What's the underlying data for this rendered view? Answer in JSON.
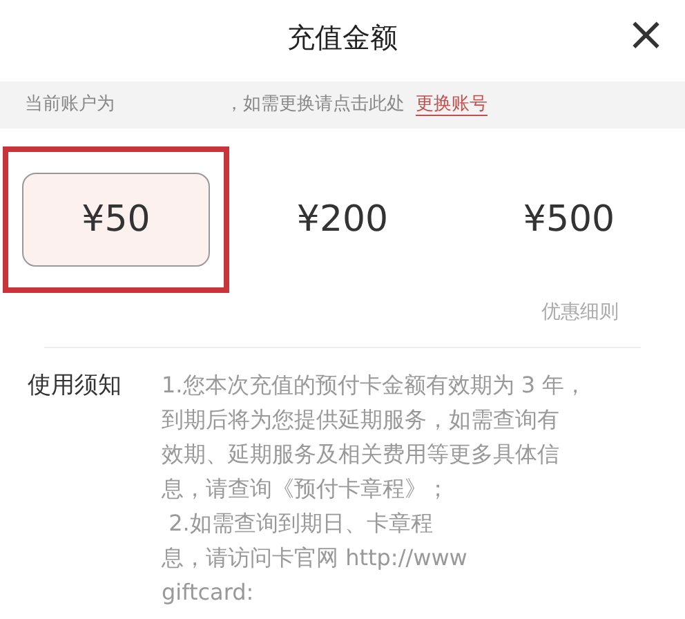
{
  "header": {
    "title": "充值金额",
    "close": "×"
  },
  "account_bar": {
    "prefix": "当前账户为",
    "hint": "，如需更换请点击此处",
    "link": "更换账号"
  },
  "amounts": [
    {
      "label": "¥50",
      "selected": true,
      "highlighted": true
    },
    {
      "label": "¥200",
      "selected": false,
      "highlighted": false
    },
    {
      "label": "¥500",
      "selected": false,
      "highlighted": false
    }
  ],
  "rules_link": "优惠细则",
  "notice": {
    "label": "使用须知",
    "lines": [
      "1.您本次充值的预付卡金额有效期为 3 年，",
      "到期后将为您提供延期服务，如需查询有",
      "效期、延期服务及相关费用等更多具体信",
      "息，请查询《预付卡章程》；",
      " 2.如需查询到期日、卡章程",
      "息，请访问卡官网 http://www",
      "giftcard:"
    ]
  }
}
